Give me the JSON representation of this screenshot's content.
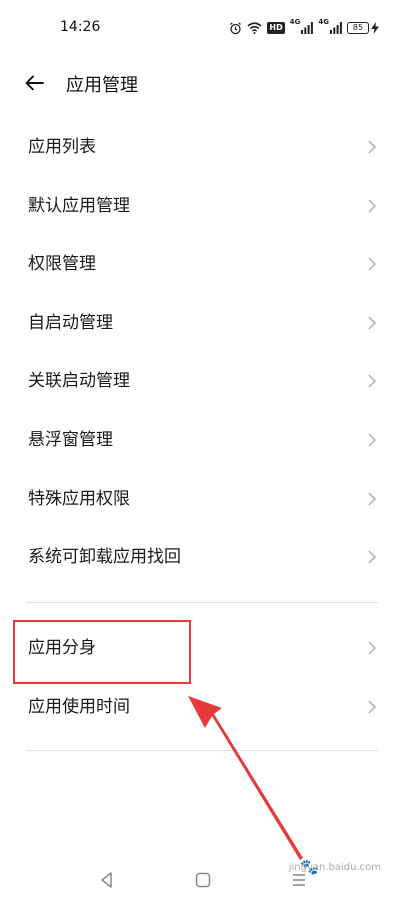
{
  "status_bar": {
    "time": "14:26",
    "network_badge": "HD",
    "signal1_label": "4G",
    "signal2_label": "4G",
    "battery_level": "85"
  },
  "header": {
    "title": "应用管理"
  },
  "menu": {
    "group1": [
      {
        "label": "应用列表"
      },
      {
        "label": "默认应用管理"
      },
      {
        "label": "权限管理"
      },
      {
        "label": "自启动管理"
      },
      {
        "label": "关联启动管理"
      },
      {
        "label": "悬浮窗管理"
      },
      {
        "label": "特殊应用权限"
      },
      {
        "label": "系统可卸载应用找回"
      }
    ],
    "group2": [
      {
        "label": "应用分身"
      },
      {
        "label": "应用使用时间"
      }
    ]
  },
  "annotation": {
    "highlight_color": "#e8393a"
  },
  "watermark": {
    "text": "jingyan.baidu.com"
  }
}
